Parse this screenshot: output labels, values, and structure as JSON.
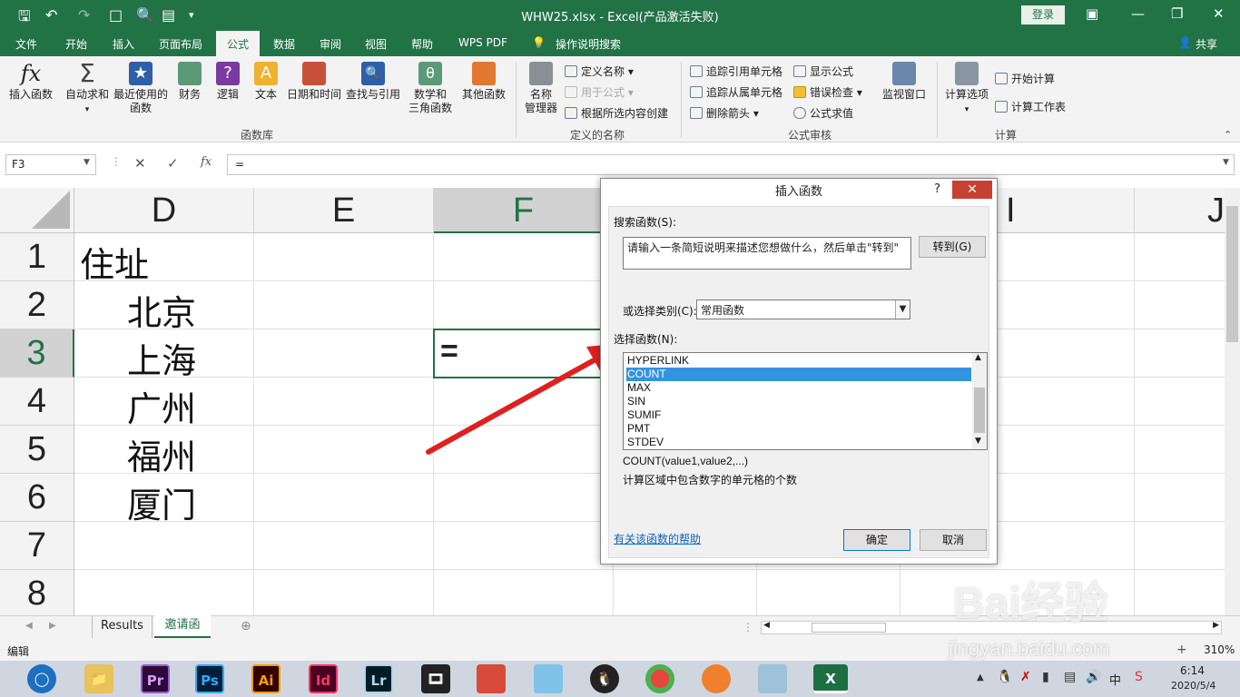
{
  "window": {
    "title": "WHW25.xlsx  -  Excel(产品激活失败)",
    "login_label": "登录",
    "share_label": "共享"
  },
  "ribbon_tabs": [
    "文件",
    "开始",
    "插入",
    "页面布局",
    "公式",
    "数据",
    "审阅",
    "视图",
    "帮助",
    "WPS PDF"
  ],
  "active_tab": "公式",
  "tell_me": "操作说明搜索",
  "ribbon": {
    "insert_function": "插入函数",
    "autosum": "自动求和",
    "recently_used_1": "最近使用的",
    "recently_used_2": "函数",
    "financial": "财务",
    "logical": "逻辑",
    "text": "文本",
    "datetime": "日期和时间",
    "lookup": "查找与引用",
    "math_1": "数学和",
    "math_2": "三角函数",
    "more_functions": "其他函数",
    "group_library": "函数库",
    "name_manager_1": "名称",
    "name_manager_2": "管理器",
    "define_name": "定义名称",
    "use_in_formula": "用于公式",
    "create_from_selection": "根据所选内容创建",
    "group_defined_names": "定义的名称",
    "trace_precedents": "追踪引用单元格",
    "trace_dependents": "追踪从属单元格",
    "remove_arrows": "删除箭头",
    "show_formulas": "显示公式",
    "error_checking": "错误检查",
    "evaluate_formula": "公式求值",
    "watch_window": "监视窗口",
    "group_auditing": "公式审核",
    "calc_options": "计算选项",
    "calc_now": "开始计算",
    "calc_sheet": "计算工作表",
    "group_calculation": "计算"
  },
  "formula_bar": {
    "name_box": "F3",
    "formula": "=",
    "fx_label": "fx"
  },
  "columns": [
    "D",
    "E",
    "F",
    "I"
  ],
  "rows": [
    "1",
    "2",
    "3",
    "4",
    "5",
    "6",
    "7",
    "8"
  ],
  "cells": {
    "d1": "住址",
    "d2": "北京",
    "d3": "上海",
    "d4": "广州",
    "d5": "福州",
    "d6": "厦门",
    "f3": "="
  },
  "sheets": [
    "Results",
    "邀请函"
  ],
  "active_sheet": "邀请函",
  "status": {
    "mode": "编辑",
    "zoom": "310%"
  },
  "dialog": {
    "title": "插入函数",
    "help_glyph": "?",
    "search_label": "搜索函数(S):",
    "search_placeholder": "请输入一条简短说明来描述您想做什么，然后单击\"转到\"",
    "go_button": "转到(G)",
    "category_label": "或选择类别(C):",
    "category_value": "常用函数",
    "select_label": "选择函数(N):",
    "functions": [
      "HYPERLINK",
      "COUNT",
      "MAX",
      "SIN",
      "SUMIF",
      "PMT",
      "STDEV"
    ],
    "selected_function": "COUNT",
    "syntax": "COUNT(value1,value2,...)",
    "description": "计算区域中包含数字的单元格的个数",
    "help_link": "有关该函数的帮助",
    "ok_button": "确定",
    "cancel_button": "取消"
  },
  "taskbar": {
    "time": "6:14",
    "date": "2020/5/4",
    "apps": [
      "Pr",
      "Ps",
      "Ai",
      "Id",
      "Lr"
    ],
    "ime": "中"
  },
  "watermark": {
    "brand": "Bai经验",
    "url": "jingyan.baidu.com"
  },
  "colors": {
    "excel_green": "#217346",
    "selection_blue": "#3393df",
    "arrow_red": "#e02020"
  }
}
